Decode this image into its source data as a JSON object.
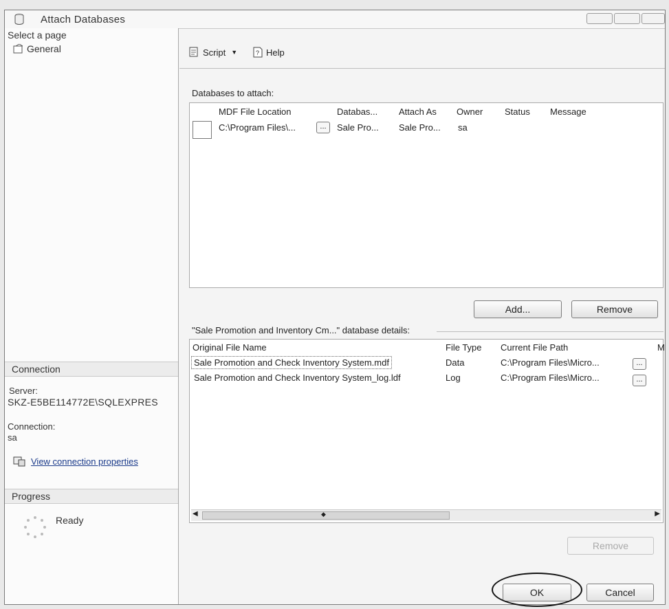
{
  "window": {
    "title": "Attach Databases"
  },
  "left": {
    "select_page_label": "Select a page",
    "pages": [
      {
        "label": "General",
        "icon": "page-icon"
      }
    ],
    "connection_header": "Connection",
    "server_label": "Server:",
    "server_value": "SKZ-E5BE114772E\\SQLEXPRES",
    "connection_label": "Connection:",
    "connection_value": "sa",
    "view_connection_link": "View connection properties",
    "progress_header": "Progress",
    "progress_status": "Ready"
  },
  "toolbar": {
    "script_label": "Script",
    "help_label": "Help"
  },
  "attach": {
    "group_label": "Databases to attach:",
    "columns": [
      "MDF File Location",
      "Databas...",
      "Attach As",
      "Owner",
      "Status",
      "Message"
    ],
    "rows": [
      {
        "mdf": "C:\\Program Files\\...",
        "browse": "...",
        "database": "Sale Pro...",
        "attach_as": "Sale Pro...",
        "owner": "sa",
        "status": "",
        "message": ""
      }
    ],
    "add_button": "Add...",
    "remove_button": "Remove"
  },
  "details": {
    "group_label": "\"Sale Promotion and Inventory Cm...\" database details:",
    "columns": [
      "Original File Name",
      "File Type",
      "Current File Path",
      "M"
    ],
    "rows": [
      {
        "name": "Sale Promotion and Check Inventory System.mdf",
        "type": "Data",
        "path": "C:\\Program Files\\Micro...",
        "browse": "..."
      },
      {
        "name": "Sale Promotion and Check Inventory System_log.ldf",
        "type": "Log",
        "path": "C:\\Program Files\\Micro...",
        "browse": "..."
      }
    ],
    "remove_button": "Remove"
  },
  "footer": {
    "ok_button": "OK",
    "cancel_button": "Cancel"
  },
  "colors": {
    "accent_link": "#1a3a8a",
    "annotation_circle": "#111111"
  }
}
